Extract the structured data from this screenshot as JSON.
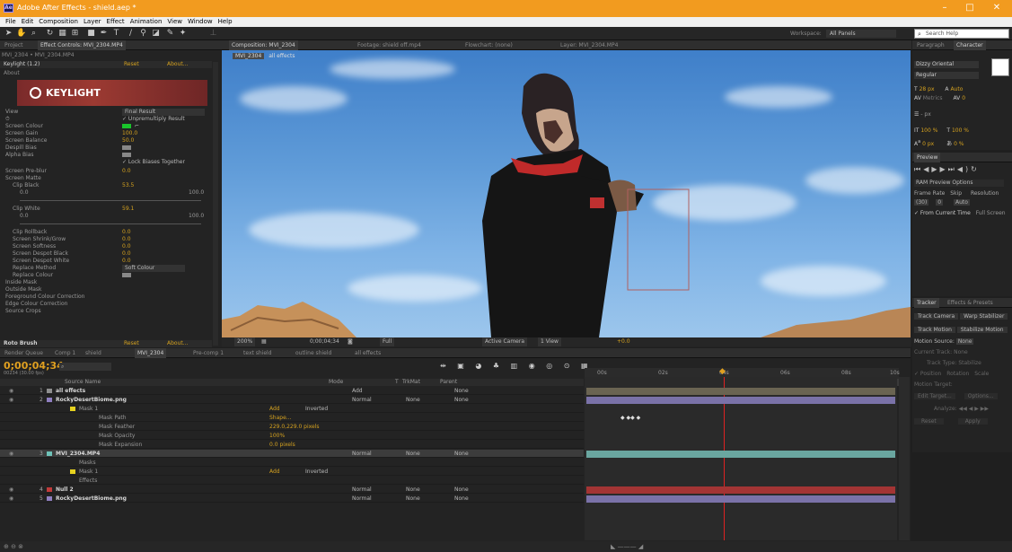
{
  "window": {
    "title": "Adobe After Effects - shield.aep *",
    "min": "–",
    "max": "□",
    "close": "✕"
  },
  "menu": [
    "File",
    "Edit",
    "Composition",
    "Layer",
    "Effect",
    "Animation",
    "View",
    "Window",
    "Help"
  ],
  "toolbar": {
    "workspace_label": "Workspace:",
    "workspace_value": "All Panels",
    "search_placeholder": "Search Help"
  },
  "left_panel": {
    "tabs": [
      "Project",
      "Effect Controls: MVI_2304.MP4"
    ],
    "subtitle": "MVI_2304 • MVI_2304.MP4",
    "effect_name": "Keylight (1.2)",
    "reset": "Reset",
    "about": "About...",
    "about_label": "About",
    "logo_text": "KEYLIGHT",
    "rows": [
      {
        "label": "View",
        "value": "Final Result"
      },
      {
        "label": "",
        "value": "✓ Unpremultiply Result"
      },
      {
        "label": "Screen Colour",
        "value": ""
      },
      {
        "label": "Screen Gain",
        "value": "100.0"
      },
      {
        "label": "Screen Balance",
        "value": "50.0"
      },
      {
        "label": "Despill Bias",
        "value": ""
      },
      {
        "label": "Alpha Bias",
        "value": ""
      },
      {
        "label": "",
        "value": "✓ Lock Biases Together"
      },
      {
        "label": "Screen Pre-blur",
        "value": "0.0"
      },
      {
        "label": "Screen Matte",
        "value": ""
      },
      {
        "label": "Clip Black",
        "value": "53.5"
      },
      {
        "label": "0.0",
        "value": "100.0"
      },
      {
        "label": "Clip White",
        "value": "59.1"
      },
      {
        "label": "0.0",
        "value": "100.0"
      },
      {
        "label": "Clip Rollback",
        "value": "0.0"
      },
      {
        "label": "Screen Shrink/Grow",
        "value": "0.0"
      },
      {
        "label": "Screen Softness",
        "value": "0.0"
      },
      {
        "label": "Screen Despot Black",
        "value": "0.0"
      },
      {
        "label": "Screen Despot White",
        "value": "0.0"
      },
      {
        "label": "Replace Method",
        "value": "Soft Colour"
      },
      {
        "label": "Replace Colour",
        "value": ""
      },
      {
        "label": "Inside Mask",
        "value": ""
      },
      {
        "label": "Outside Mask",
        "value": ""
      },
      {
        "label": "Foreground Colour Correction",
        "value": ""
      },
      {
        "label": "Edge Colour Correction",
        "value": ""
      },
      {
        "label": "Source Crops",
        "value": ""
      }
    ],
    "roto": "Roto Brush",
    "roto_reset": "Reset",
    "roto_about": "About..."
  },
  "viewer": {
    "tabs": [
      "Composition: MVI_2304",
      "Footage: shield off.mp4",
      "Flowchart: (none)",
      "Layer: MVI_2304.MP4"
    ],
    "crumbs": [
      "MVI_2304",
      "all effects"
    ],
    "bottom": [
      "200%",
      "0;00;04;34",
      "Full",
      "Active Camera",
      "1 View",
      "+0.0"
    ]
  },
  "right_panel": {
    "tabs": [
      "Paragraph",
      "Character"
    ],
    "font": "Dizzy Oriental",
    "style": "Regular",
    "size": "28 px",
    "leading": "Auto",
    "kerning": "Metrics",
    "tracking": "0",
    "stroke": "- px",
    "vscale": "100 %",
    "hscale": "100 %",
    "baseline": "0 px",
    "tsume": "0 %",
    "preview_tab": "Preview",
    "ram": "RAM Preview Options",
    "fr_label": "Frame Rate",
    "skip_label": "Skip",
    "res_label": "Resolution",
    "fr_val": "(30)",
    "skip_val": "0",
    "res_val": "Auto",
    "from_current": "✓ From Current Time",
    "full_screen": "Full Screen",
    "tracker_tabs": [
      "Tracker",
      "Effects & Presets"
    ],
    "track_camera": "Track Camera",
    "warp_stab": "Warp Stabilizer",
    "track_motion": "Track Motion",
    "stabilize_motion": "Stabilize Motion",
    "motion_source": "Motion Source:",
    "motion_source_val": "None",
    "current_track": "Current Track:",
    "current_track_val": "None",
    "track_type": "Track Type:",
    "track_type_val": "Stabilize",
    "position": "✓ Position",
    "rotation": "Rotation",
    "scale": "Scale",
    "motion_target": "Motion Target:",
    "edit_target": "Edit Target...",
    "options": "Options...",
    "analyze": "Analyze:",
    "reset": "Reset",
    "apply": "Apply"
  },
  "timeline": {
    "tabs": [
      "Render Queue",
      "Comp 1",
      "shield",
      "MVI_2304",
      "Pre-comp 1",
      "text shield",
      "outline shield",
      "all effects"
    ],
    "timecode": "0;00;04;34",
    "timecode_sub": "00234 (30.00 fps)",
    "columns": [
      "Source Name",
      "Mode",
      "T",
      "TrkMat",
      "Parent"
    ],
    "ruler": [
      "00s",
      "02s",
      "04s",
      "06s",
      "08s",
      "10s"
    ],
    "layers": [
      {
        "num": "1",
        "name": "all effects",
        "mode": "Add",
        "trk": "",
        "parent": "None",
        "color": "#8f8f8f"
      },
      {
        "num": "2",
        "name": "RockyDesertBiome.png",
        "mode": "Normal",
        "trk": "None",
        "parent": "None",
        "color": "#8f7fc0"
      },
      {
        "num": "",
        "name": "Mask 1",
        "mode": "Add",
        "trk": "Inverted",
        "parent": "",
        "color": "#e6d21f"
      },
      {
        "num": "",
        "name": "Mask Path",
        "mode": "Shape...",
        "trk": "",
        "parent": "",
        "color": ""
      },
      {
        "num": "",
        "name": "Mask Feather",
        "mode": "229.0,229.0 pixels",
        "trk": "",
        "parent": "",
        "color": ""
      },
      {
        "num": "",
        "name": "Mask Opacity",
        "mode": "100%",
        "trk": "",
        "parent": "",
        "color": ""
      },
      {
        "num": "",
        "name": "Mask Expansion",
        "mode": "0.0 pixels",
        "trk": "",
        "parent": "",
        "color": ""
      },
      {
        "num": "3",
        "name": "MVI_2304.MP4",
        "mode": "Normal",
        "trk": "None",
        "parent": "None",
        "color": "#6fc2b8"
      },
      {
        "num": "",
        "name": "Masks",
        "mode": "",
        "trk": "",
        "parent": "",
        "color": ""
      },
      {
        "num": "",
        "name": "Mask 1",
        "mode": "Add",
        "trk": "Inverted",
        "parent": "",
        "color": "#e6d21f"
      },
      {
        "num": "",
        "name": "Effects",
        "mode": "",
        "trk": "",
        "parent": "",
        "color": ""
      },
      {
        "num": "4",
        "name": "Null 2",
        "mode": "Normal",
        "trk": "None",
        "parent": "None",
        "color": "#c23b3b"
      },
      {
        "num": "5",
        "name": "RockyDesertBiome.png",
        "mode": "Normal",
        "trk": "None",
        "parent": "None",
        "color": "#8f7fc0"
      }
    ]
  }
}
